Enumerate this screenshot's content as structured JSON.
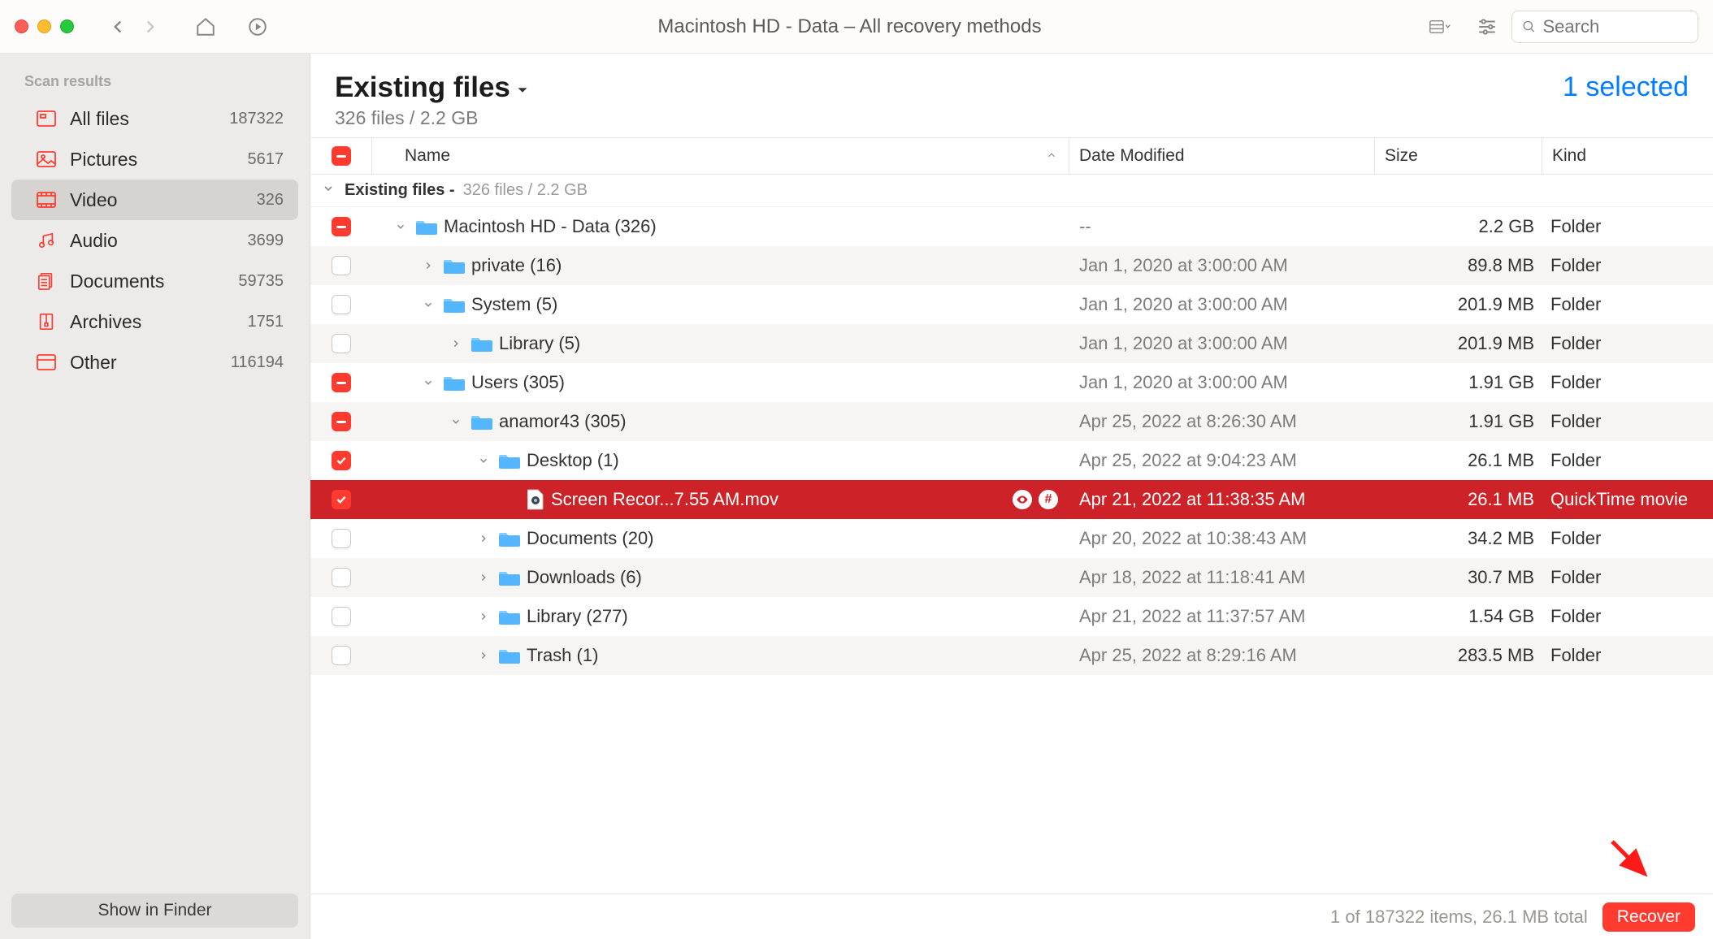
{
  "toolbar": {
    "title": "Macintosh HD - Data – All recovery methods",
    "search_placeholder": "Search"
  },
  "sidebar": {
    "header": "Scan results",
    "items": [
      {
        "label": "All files",
        "count": "187322",
        "icon": "all"
      },
      {
        "label": "Pictures",
        "count": "5617",
        "icon": "pictures"
      },
      {
        "label": "Video",
        "count": "326",
        "icon": "video",
        "selected": true
      },
      {
        "label": "Audio",
        "count": "3699",
        "icon": "audio"
      },
      {
        "label": "Documents",
        "count": "59735",
        "icon": "documents"
      },
      {
        "label": "Archives",
        "count": "1751",
        "icon": "archives"
      },
      {
        "label": "Other",
        "count": "116194",
        "icon": "other"
      }
    ],
    "finder_button": "Show in Finder"
  },
  "main": {
    "title": "Existing files",
    "subtitle": "326 files / 2.2 GB",
    "selected_text": "1 selected",
    "columns": {
      "name": "Name",
      "date": "Date Modified",
      "size": "Size",
      "kind": "Kind"
    },
    "group": {
      "label": "Existing files -",
      "meta": "326 files / 2.2 GB"
    },
    "rows": [
      {
        "indent": 0,
        "check": "minus",
        "disc": "down",
        "icon": "folder",
        "name": "Macintosh HD - Data (326)",
        "date": "--",
        "size": "2.2 GB",
        "kind": "Folder"
      },
      {
        "indent": 1,
        "check": "empty",
        "disc": "right",
        "icon": "folder",
        "name": "private (16)",
        "date": "Jan 1, 2020 at 3:00:00 AM",
        "size": "89.8 MB",
        "kind": "Folder"
      },
      {
        "indent": 1,
        "check": "empty",
        "disc": "down",
        "icon": "folder",
        "name": "System (5)",
        "date": "Jan 1, 2020 at 3:00:00 AM",
        "size": "201.9 MB",
        "kind": "Folder"
      },
      {
        "indent": 2,
        "check": "empty",
        "disc": "right",
        "icon": "folder",
        "name": "Library (5)",
        "date": "Jan 1, 2020 at 3:00:00 AM",
        "size": "201.9 MB",
        "kind": "Folder"
      },
      {
        "indent": 1,
        "check": "minus",
        "disc": "down",
        "icon": "folder",
        "name": "Users (305)",
        "date": "Jan 1, 2020 at 3:00:00 AM",
        "size": "1.91 GB",
        "kind": "Folder"
      },
      {
        "indent": 2,
        "check": "minus",
        "disc": "down",
        "icon": "folder",
        "name": "anamor43 (305)",
        "date": "Apr 25, 2022 at 8:26:30 AM",
        "size": "1.91 GB",
        "kind": "Folder"
      },
      {
        "indent": 3,
        "check": "check",
        "disc": "down",
        "icon": "folder",
        "name": "Desktop (1)",
        "date": "Apr 25, 2022 at 9:04:23 AM",
        "size": "26.1 MB",
        "kind": "Folder"
      },
      {
        "indent": 4,
        "check": "check",
        "disc": "none",
        "icon": "file",
        "name": "Screen Recor...7.55 AM.mov",
        "date": "Apr 21, 2022 at 11:38:35 AM",
        "size": "26.1 MB",
        "kind": "QuickTime movie",
        "selected": true,
        "badges": true
      },
      {
        "indent": 3,
        "check": "empty",
        "disc": "right",
        "icon": "folder",
        "name": "Documents (20)",
        "date": "Apr 20, 2022 at 10:38:43 AM",
        "size": "34.2 MB",
        "kind": "Folder"
      },
      {
        "indent": 3,
        "check": "empty",
        "disc": "right",
        "icon": "folder",
        "name": "Downloads (6)",
        "date": "Apr 18, 2022 at 11:18:41 AM",
        "size": "30.7 MB",
        "kind": "Folder"
      },
      {
        "indent": 3,
        "check": "empty",
        "disc": "right",
        "icon": "folder",
        "name": "Library (277)",
        "date": "Apr 21, 2022 at 11:37:57 AM",
        "size": "1.54 GB",
        "kind": "Folder"
      },
      {
        "indent": 3,
        "check": "empty",
        "disc": "right",
        "icon": "folder",
        "name": "Trash (1)",
        "date": "Apr 25, 2022 at 8:29:16 AM",
        "size": "283.5 MB",
        "kind": "Folder"
      }
    ]
  },
  "footer": {
    "status": "1 of 187322 items, 26.1 MB total",
    "recover": "Recover"
  }
}
